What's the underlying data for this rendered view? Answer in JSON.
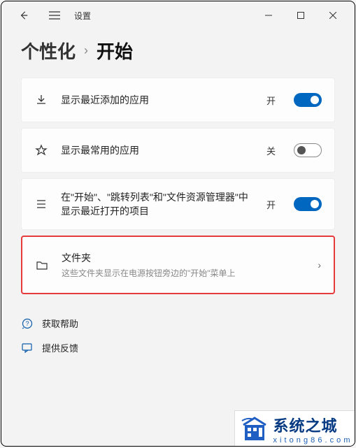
{
  "window": {
    "app_title": "设置",
    "min_tip": "Minimize",
    "max_tip": "Maximize",
    "close_tip": "Close"
  },
  "breadcrumb": {
    "parent": "个性化",
    "sep": "›",
    "current": "开始"
  },
  "settings": [
    {
      "title": "显示最近添加的应用",
      "sub": "",
      "state_label": "开",
      "state": "on",
      "has_chevron": false,
      "highlight": false
    },
    {
      "title": "显示最常用的应用",
      "sub": "",
      "state_label": "关",
      "state": "off",
      "has_chevron": false,
      "highlight": false
    },
    {
      "title": "在\"开始\"、\"跳转列表\"和\"文件资源管理器\"中显示最近打开的项目",
      "sub": "",
      "state_label": "开",
      "state": "on",
      "has_chevron": false,
      "highlight": false
    },
    {
      "title": "文件夹",
      "sub": "这些文件夹显示在电源按钮旁边的\"开始\"菜单上",
      "state_label": "",
      "state": "",
      "has_chevron": true,
      "highlight": true
    }
  ],
  "links": {
    "help": "获取帮助",
    "feedback": "提供反馈"
  },
  "watermark": {
    "title": "系统之城",
    "url": "x i t o n g 8 6 . c o m"
  }
}
